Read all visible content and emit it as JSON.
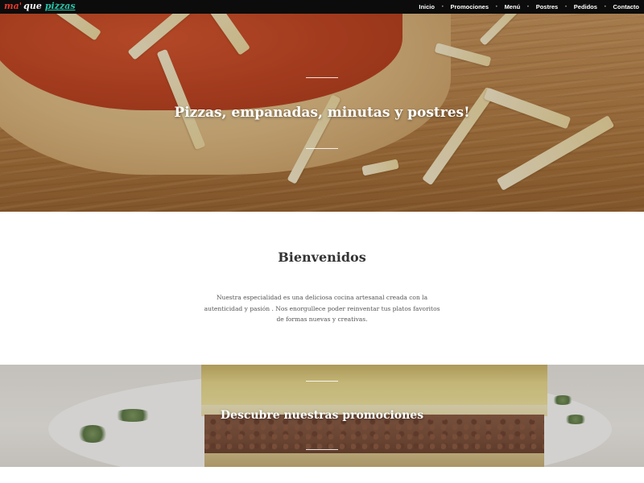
{
  "header": {
    "logo": {
      "part1": "ma'",
      "part2": "que",
      "part3": "pizzas"
    },
    "nav": [
      {
        "label": "Inicio"
      },
      {
        "label": "Promociones"
      },
      {
        "label": "Menú"
      },
      {
        "label": "Postres"
      },
      {
        "label": "Pedidos"
      },
      {
        "label": "Contacto"
      }
    ],
    "nav_separator": "•"
  },
  "hero": {
    "title": "Pizzas, empanadas, minutas y postres!"
  },
  "welcome": {
    "title": "Bienvenidos",
    "text": "Nuestra especialidad es una deliciosa cocina artesanal creada con la autenticidad y pasión . Nos enorgullece poder reinventar tus platos favoritos de formas nuevas y creativas."
  },
  "promo": {
    "title": "Descubre nuestras promociones"
  },
  "colors": {
    "topbar": "#0c0c0c",
    "logo_red": "#e8392b",
    "logo_teal": "#29c4a9",
    "heading": "#333333"
  }
}
